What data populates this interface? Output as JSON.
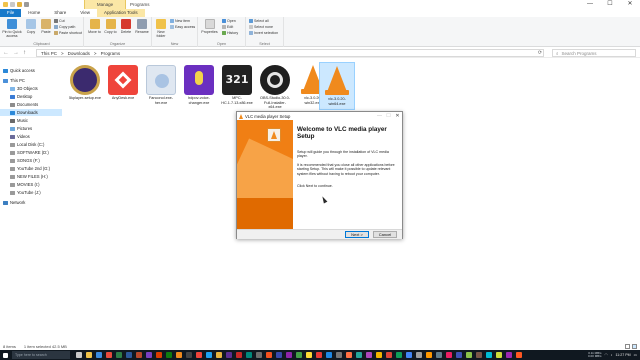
{
  "window": {
    "contextual_tab": "Manage",
    "title": "Programs",
    "controls": {
      "minimize": "—",
      "maximize": "☐",
      "close": "✕"
    }
  },
  "ribbon_tabs": [
    "File",
    "Home",
    "Share",
    "View",
    "Application Tools"
  ],
  "ribbon": {
    "clipboard": {
      "label": "Clipboard",
      "pin": "Pin to Quick access",
      "copy": "Copy",
      "paste": "Paste",
      "cut": "Cut",
      "copy_path": "Copy path",
      "paste_shortcut": "Paste shortcut"
    },
    "organize": {
      "label": "Organize",
      "move_to": "Move to",
      "copy_to": "Copy to",
      "delete": "Delete",
      "rename": "Rename"
    },
    "new": {
      "label": "New",
      "new_folder": "New folder",
      "new_item": "New item",
      "easy_access": "Easy access"
    },
    "open": {
      "label": "Open",
      "properties": "Properties",
      "open": "Open",
      "edit": "Edit",
      "history": "History"
    },
    "select": {
      "label": "Select",
      "select_all": "Select all",
      "select_none": "Select none",
      "invert": "Invert selection"
    }
  },
  "address": {
    "back": "←",
    "forward": "→",
    "up": "↑",
    "crumbs": [
      "This PC",
      ">",
      "Downloads",
      ">",
      "Programs"
    ],
    "refresh": "⟳",
    "search_placeholder": "Search Programs"
  },
  "nav": [
    {
      "label": "Quick access",
      "color": "#2b88d8"
    },
    {
      "label": "This PC",
      "color": "#4a90d9"
    },
    {
      "label": "3D Objects",
      "color": "#7fb6e8"
    },
    {
      "label": "Desktop",
      "color": "#3a7bd5"
    },
    {
      "label": "Documents",
      "color": "#8c8c8c"
    },
    {
      "label": "Downloads",
      "color": "#2b88d8"
    },
    {
      "label": "Music",
      "color": "#6a6a6a"
    },
    {
      "label": "Pictures",
      "color": "#6ea8dc"
    },
    {
      "label": "Videos",
      "color": "#6b6b9a"
    },
    {
      "label": "Local Disk (C:)",
      "color": "#9a9a9a"
    },
    {
      "label": "SOFTWARE (D:)",
      "color": "#9a9a9a"
    },
    {
      "label": "SONGS (F:)",
      "color": "#9a9a9a"
    },
    {
      "label": "YouTube 2nd (G:)",
      "color": "#9a9a9a"
    },
    {
      "label": "NEW FILES (H:)",
      "color": "#9a9a9a"
    },
    {
      "label": "MOVIES (I:)",
      "color": "#9a9a9a"
    },
    {
      "label": "YouTube (J:)",
      "color": "#9a9a9a"
    },
    {
      "label": "Network",
      "color": "#3c7fc1"
    }
  ],
  "files": [
    {
      "name": "5kplayer-setup.exe",
      "icon": "5kplayer-icon",
      "color": "#3b2a6e"
    },
    {
      "name": "AnyDesk.exe",
      "icon": "anydesk-icon",
      "color": "#ef443b"
    },
    {
      "name": "Fanconol.exe-her.exe",
      "icon": "installer-icon",
      "color": "#dfe7f1"
    },
    {
      "name": "hdpov-voice-changer.exe",
      "icon": "voice-changer-icon",
      "color": "#6b2fc0"
    },
    {
      "name": "MPC-HC.1.7.13.x86.exe",
      "icon": "mpc-hc-icon",
      "color": "#222222"
    },
    {
      "name": "OBS-Studio-30.0-Full-Installer-x64.exe",
      "icon": "obs-icon",
      "color": "#1f1f1f"
    },
    {
      "name": "vlc-3.0.20-win32.exe",
      "icon": "vlc-icon",
      "color": "#f08a1d"
    },
    {
      "name": "vlc-3.0.20-win64.exe",
      "icon": "vlc-icon",
      "color": "#f08a1d"
    }
  ],
  "dialog": {
    "title": "VLC media player Setup",
    "heading": "Welcome to VLC media player Setup",
    "para1": "Setup will guide you through the installation of VLC media player.",
    "para2": "It is recommended that you close all other applications before starting Setup. This will make it possible to update relevant system files without having to reboot your computer.",
    "para3": "Click Next to continue.",
    "next": "Next >",
    "cancel": "Cancel",
    "controls": {
      "minimize": "—",
      "maximize": "☐",
      "close": "✕"
    }
  },
  "status": {
    "count": "8 items",
    "selection": "1 item selected  42.5 MB"
  },
  "taskbar": {
    "search_placeholder": "Type here to search",
    "stats": "0.11 MB/s\n0.00 MB/s",
    "time": "11:27 PM"
  }
}
